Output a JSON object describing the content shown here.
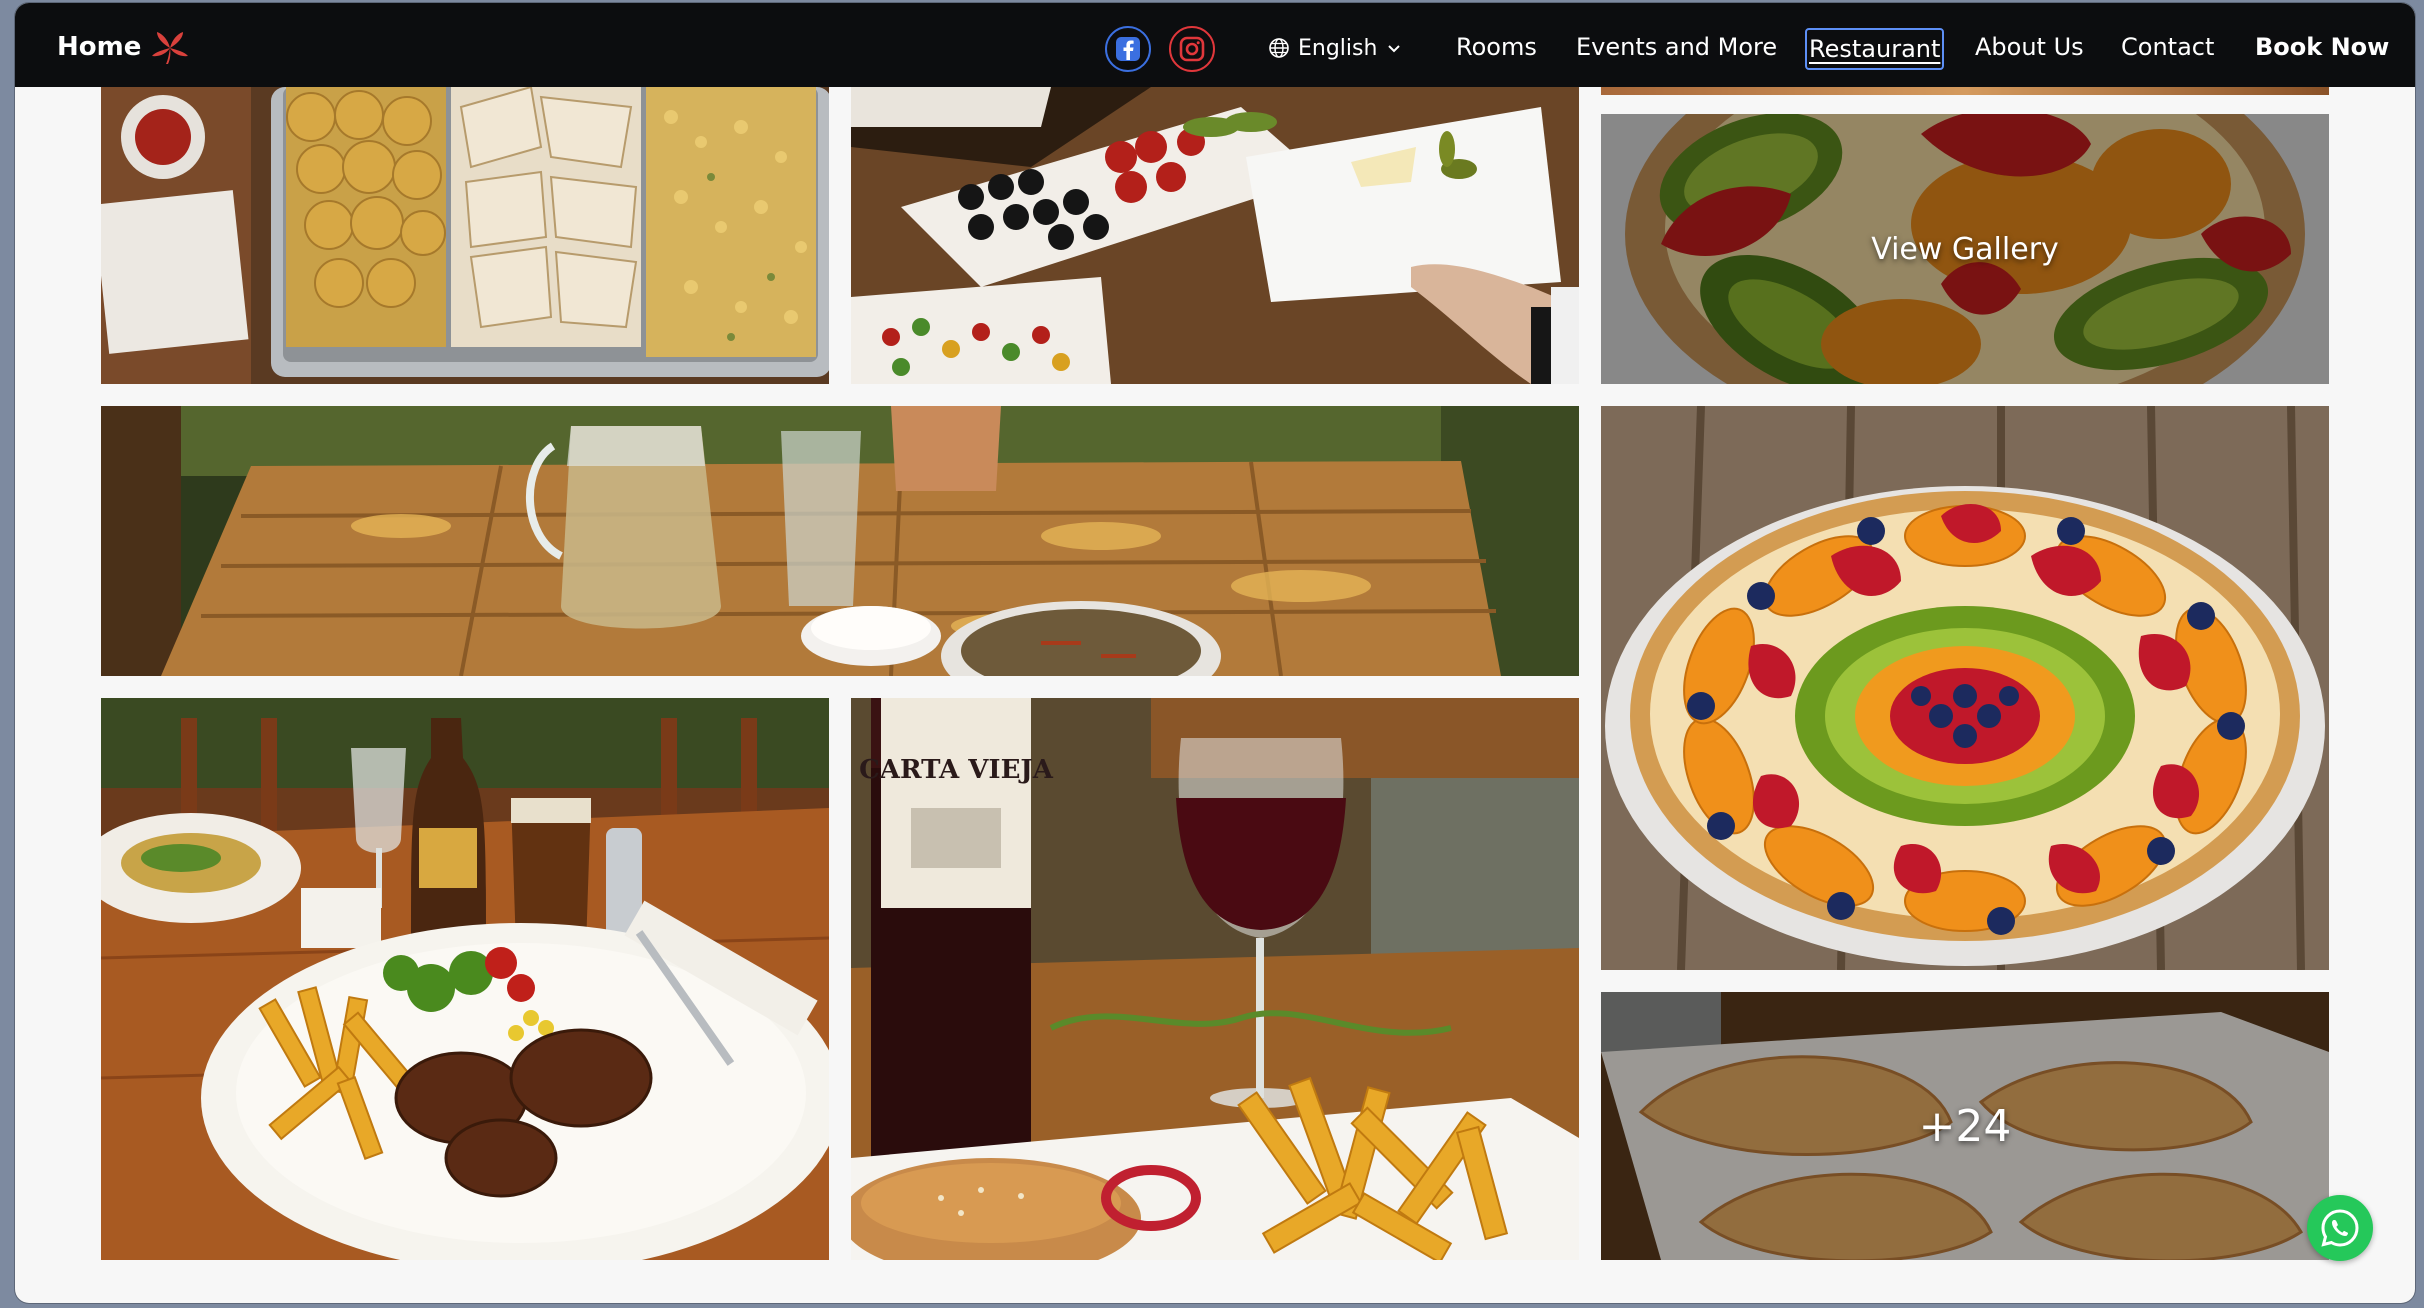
{
  "navbar": {
    "brand": "Home",
    "social": [
      {
        "name": "facebook-icon"
      },
      {
        "name": "instagram-icon"
      }
    ],
    "language": "English",
    "items": [
      {
        "label": "Rooms"
      },
      {
        "label": "Events and More"
      },
      {
        "label": "Restaurant",
        "active": true
      },
      {
        "label": "About Us"
      },
      {
        "label": "Contact"
      },
      {
        "label": "Book Now"
      }
    ]
  },
  "gallery": {
    "view_gallery_label": "View Gallery",
    "more_count": "+24"
  },
  "colors": {
    "navbar_bg": "#0c0d0f",
    "page_bg": "#f7f7f7",
    "active_outline": "#5d8ff6",
    "brand_leaf": "#d9413c",
    "whatsapp": "#25c85a"
  }
}
